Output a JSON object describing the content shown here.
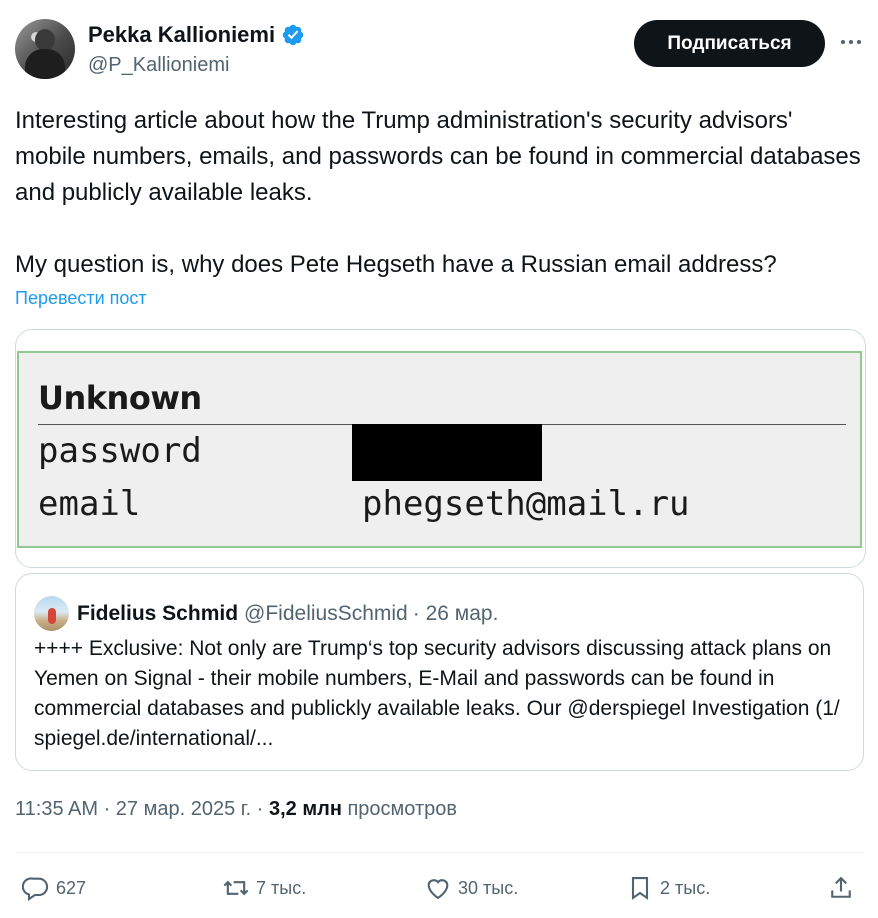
{
  "author": {
    "name": "Pekka Kallioniemi",
    "handle": "@P_Kallioniemi",
    "verified": true
  },
  "header": {
    "subscribe_label": "Подписаться"
  },
  "tweet": {
    "text": "Interesting article about how the Trump administration's security advisors' mobile numbers, emails, and passwords can be found in commercial databases and publicly available leaks.\n\nMy question is, why does Pete Hegseth have a Russian email address?",
    "translate_label": "Перевести пост"
  },
  "media": {
    "title": "Unknown",
    "password_label": "password",
    "email_label": "email",
    "email_value": "phegseth@mail.ru"
  },
  "quote": {
    "name": "Fidelius Schmid",
    "handle": "@FideliusSchmid",
    "date": "· 26 мар.",
    "text": "++++ Exclusive: Not only are Trump‘s top security advisors discussing attack plans on Yemen on Signal - their mobile numbers, E-Mail and passwords can be found in commercial databases and publickly available leaks. Our @derspiegel Investigation (1/ spiegel.de/international/..."
  },
  "meta": {
    "time_date": "11:35 AM · 27 мар. 2025 г. ·",
    "views_count": "3,2 млн",
    "views_label": "просмотров"
  },
  "actions": {
    "replies": "627",
    "reposts": "7 тыс.",
    "likes": "30 тыс.",
    "bookmarks": "2 тыс."
  },
  "colors": {
    "accent": "#1d9bf0",
    "text_primary": "#0f1419",
    "text_secondary": "#536471",
    "border": "#cfd9de"
  },
  "icons": [
    "verified-badge-icon",
    "more-icon",
    "reply-icon",
    "repost-icon",
    "like-icon",
    "bookmark-icon",
    "share-icon"
  ]
}
